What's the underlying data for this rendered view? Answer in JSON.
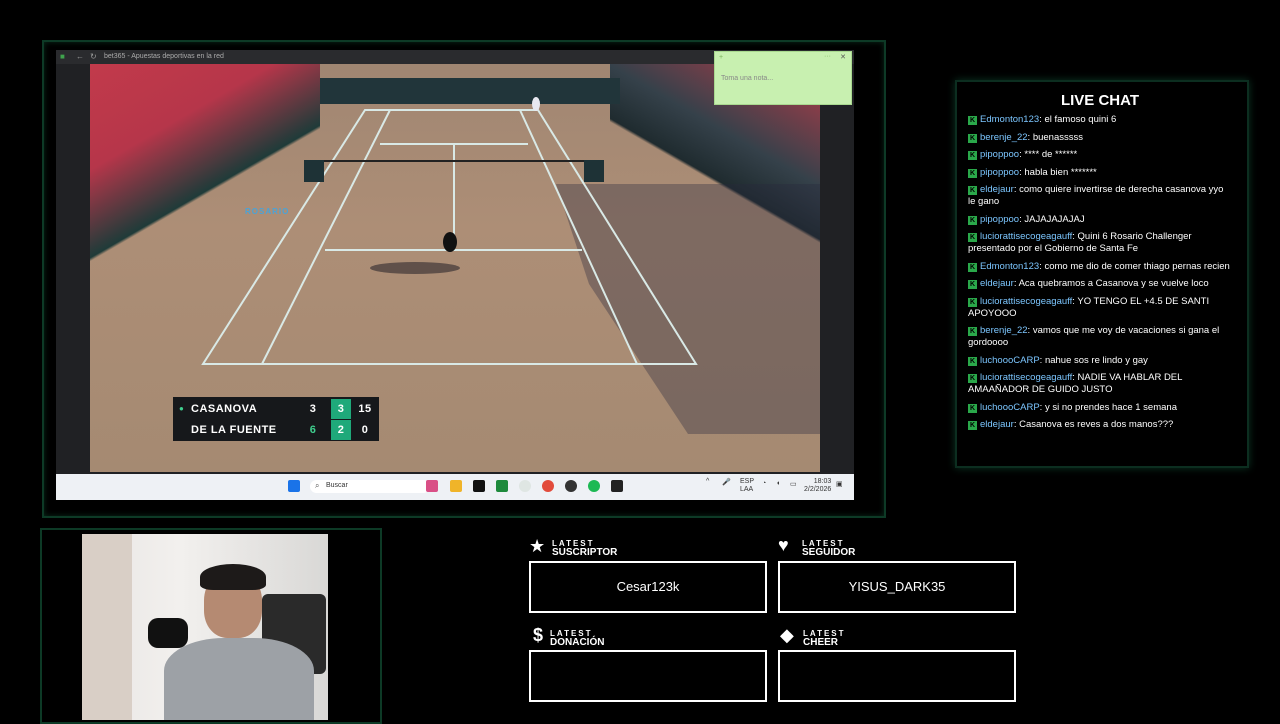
{
  "browser": {
    "tab_title": "bet365 - Apuestas deportivas en la red"
  },
  "sticky_note": {
    "placeholder": "Toma una nota..."
  },
  "video": {
    "court_text": "ROSARIO",
    "scoreboard": {
      "rows": [
        {
          "name": "CASANOVA",
          "sets_won": "3",
          "games": "3",
          "points": "15",
          "serving": true
        },
        {
          "name": "DE LA FUENTE",
          "sets_won": "6",
          "games": "2",
          "points": "0",
          "serving": false
        }
      ]
    }
  },
  "taskbar": {
    "search_placeholder": "Buscar",
    "lang_line1": "ESP",
    "lang_line2": "LAA",
    "time": "18:03",
    "date": "2/2/2026"
  },
  "chat": {
    "title": "LIVE CHAT",
    "messages": [
      {
        "user": "Edmonton123",
        "text": "el famoso quini 6"
      },
      {
        "user": "berenje_22",
        "text": "buenasssss"
      },
      {
        "user": "pipoppoo",
        "text": "**** de ******"
      },
      {
        "user": "pipoppoo",
        "text": "habla bien *******"
      },
      {
        "user": "eldejaur",
        "text": "como quiere invertirse de derecha casanova yyo le gano"
      },
      {
        "user": "pipoppoo",
        "text": "JAJAJAJAJAJ"
      },
      {
        "user": "luciorattisecogeagauff",
        "text": "Quini 6 Rosario Challenger presentado por el Gobierno de Santa Fe"
      },
      {
        "user": "Edmonton123",
        "text": "como me dio de comer thiago pernas recien"
      },
      {
        "user": "eldejaur",
        "text": "Aca quebramos a Casanova y se vuelve loco"
      },
      {
        "user": "luciorattisecogeagauff",
        "text": "YO TENGO EL +4.5 DE SANTI APOYOOO"
      },
      {
        "user": "berenje_22",
        "text": "vamos que me voy de vacaciones si gana el gordoooo"
      },
      {
        "user": "luchoooCARP",
        "text": "nahue sos re lindo y gay"
      },
      {
        "user": "luciorattisecogeagauff",
        "text": "NADIE VA HABLAR DEL AMAAÑADOR DE GUIDO JUSTO"
      },
      {
        "user": "luchoooCARP",
        "text": "y si no prendes hace 1 semana"
      },
      {
        "user": "eldejaur",
        "text": "Casanova es reves a dos manos???"
      }
    ]
  },
  "alerts": {
    "suscriptor": {
      "line1": "LATEST",
      "line2": "SUSCRIPTOR",
      "value": "Cesar123k"
    },
    "seguidor": {
      "line1": "LATEST",
      "line2": "SEGUIDOR",
      "value": "YISUS_DARK35"
    },
    "donacion": {
      "line1": "LATEST",
      "line2": "DONACIÓN",
      "value": ""
    },
    "cheer": {
      "line1": "LATEST",
      "line2": "CHEER",
      "value": ""
    }
  },
  "colors": {
    "accent_green": "#2aa84a",
    "username_blue": "#7cc6ff",
    "score_highlight": "#1fa97a",
    "score_winner": "#3fd08f"
  }
}
